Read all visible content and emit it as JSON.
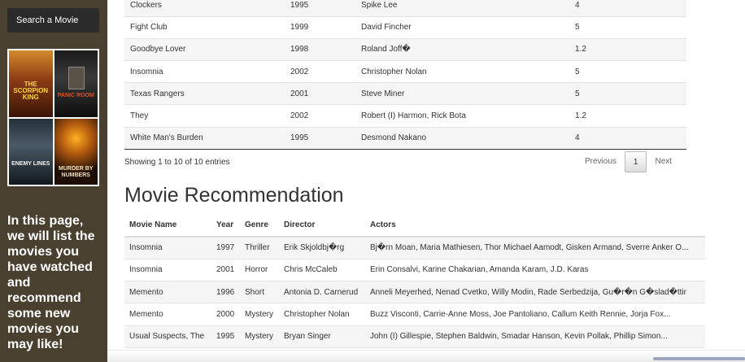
{
  "sidebar": {
    "search_button": "Search a Movie",
    "posters": [
      {
        "title": "THE SCORPION KING"
      },
      {
        "title": "PANIC ROOM"
      },
      {
        "title": "ENEMY LINES"
      },
      {
        "title": "MURDER BY NUMBERS"
      }
    ],
    "intro_text": "In this page, we will list the movies you have watched and recommend some new movies you may like!"
  },
  "watched_table": {
    "rows": [
      {
        "title": "Clockers",
        "year": "1995",
        "director": "Spike Lee",
        "rating": "4"
      },
      {
        "title": "Fight Club",
        "year": "1999",
        "director": "David Fincher",
        "rating": "5"
      },
      {
        "title": "Goodbye Lover",
        "year": "1998",
        "director": "Roland Joff�",
        "rating": "1.2"
      },
      {
        "title": "Insomnia",
        "year": "2002",
        "director": "Christopher Nolan",
        "rating": "5"
      },
      {
        "title": "Texas Rangers",
        "year": "2001",
        "director": "Steve Miner",
        "rating": "5"
      },
      {
        "title": "They",
        "year": "2002",
        "director": "Robert (I) Harmon, Rick Bota",
        "rating": "1.2"
      },
      {
        "title": "White Man's Burden",
        "year": "1995",
        "director": "Desmond Nakano",
        "rating": "4"
      }
    ],
    "info": "Showing 1 to 10 of 10 entries",
    "pagination": {
      "previous": "Previous",
      "page": "1",
      "next": "Next"
    }
  },
  "recommendation": {
    "heading": "Movie Recommendation",
    "columns": {
      "name": "Movie Name",
      "year": "Year",
      "genre": "Genre",
      "director": "Director",
      "actors": "Actors"
    },
    "rows": [
      {
        "name": "Insomnia",
        "year": "1997",
        "genre": "Thriller",
        "director": "Erik Skjoldbj�rg",
        "actors": "Bj�rn Moan, Maria Mathiesen, Thor Michael Aamodt, Gisken Armand, Sverre Anker O..."
      },
      {
        "name": "Insomnia",
        "year": "2001",
        "genre": "Horror",
        "director": "Chris McCaleb",
        "actors": "Erin Consalvi, Karine Chakarian, Amanda Karam, J.D. Karas"
      },
      {
        "name": "Memento",
        "year": "1996",
        "genre": "Short",
        "director": "Antonia D. Carnerud",
        "actors": "Anneli Meyerhed, Nenad Cvetko, Willy Modin, Rade Serbedzija, Gu�r�n G�slad�ttir"
      },
      {
        "name": "Memento",
        "year": "2000",
        "genre": "Mystery",
        "director": "Christopher Nolan",
        "actors": "Buzz Visconti, Carrie-Anne Moss, Joe Pantoliano, Callum Keith Rennie, Jorja Fox..."
      },
      {
        "name": "Usual Suspects, The",
        "year": "1995",
        "genre": "Mystery",
        "director": "Bryan Singer",
        "actors": "John (I) Gillespie, Stephen Baldwin, Smadar Hanson, Kevin Pollak, Phillip Simon..."
      }
    ]
  }
}
